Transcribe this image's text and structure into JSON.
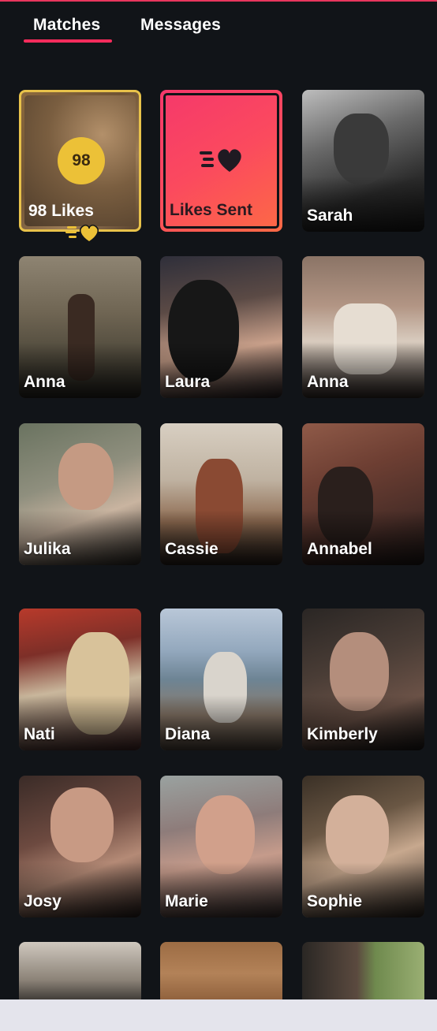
{
  "tabs": {
    "matches_label": "Matches",
    "messages_label": "Messages",
    "active": "Matches"
  },
  "likes_card": {
    "count": "98",
    "label": "98 Likes"
  },
  "likes_sent_card": {
    "label": "Likes Sent"
  },
  "matches": [
    {
      "name": "Sarah"
    },
    {
      "name": "Anna"
    },
    {
      "name": "Laura"
    },
    {
      "name": "Anna"
    },
    {
      "name": "Julika"
    },
    {
      "name": "Cassie"
    },
    {
      "name": "Annabel"
    },
    {
      "name": "Nati"
    },
    {
      "name": "Diana"
    },
    {
      "name": "Kimberly"
    },
    {
      "name": "Josy"
    },
    {
      "name": "Marie"
    },
    {
      "name": "Sophie"
    }
  ],
  "colors": {
    "background": "#111418",
    "accent": "#fd2c5c",
    "gold": "#ecc137"
  }
}
